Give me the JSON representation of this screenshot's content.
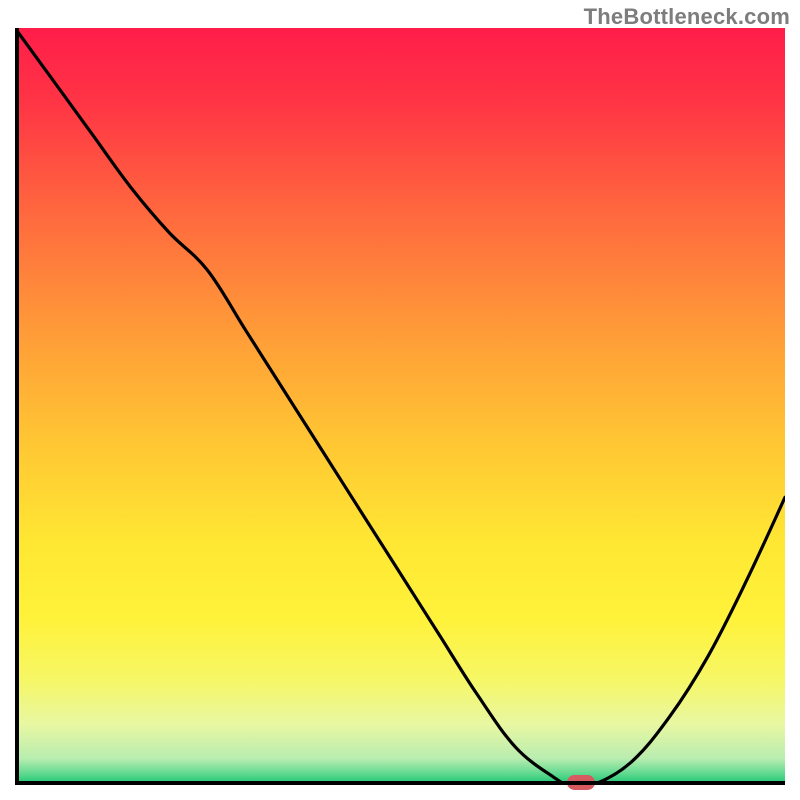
{
  "watermark": "TheBottleneck.com",
  "chart_data": {
    "type": "line",
    "title": "",
    "xlabel": "",
    "ylabel": "",
    "xlim": [
      0,
      100
    ],
    "ylim": [
      0,
      100
    ],
    "x": [
      0,
      5,
      10,
      15,
      20,
      25,
      30,
      35,
      40,
      45,
      50,
      55,
      60,
      65,
      70,
      72,
      75,
      80,
      85,
      90,
      95,
      100
    ],
    "values": [
      100,
      93,
      86,
      79,
      73,
      68,
      60,
      52,
      44,
      36,
      28,
      20,
      12,
      5,
      1,
      0,
      0,
      3,
      9,
      17,
      27,
      38
    ],
    "marker": {
      "x": 73.5,
      "y": 0
    },
    "background": {
      "stops": [
        {
          "pos": 0.0,
          "color": "#ff1d4a"
        },
        {
          "pos": 0.1,
          "color": "#ff3545"
        },
        {
          "pos": 0.25,
          "color": "#ff6a3e"
        },
        {
          "pos": 0.4,
          "color": "#ff9b38"
        },
        {
          "pos": 0.55,
          "color": "#ffc733"
        },
        {
          "pos": 0.68,
          "color": "#ffe733"
        },
        {
          "pos": 0.78,
          "color": "#fff23a"
        },
        {
          "pos": 0.86,
          "color": "#f6f765"
        },
        {
          "pos": 0.92,
          "color": "#e8f7a2"
        },
        {
          "pos": 0.965,
          "color": "#b9edb0"
        },
        {
          "pos": 0.985,
          "color": "#5fd98f"
        },
        {
          "pos": 1.0,
          "color": "#15c46f"
        }
      ]
    }
  }
}
